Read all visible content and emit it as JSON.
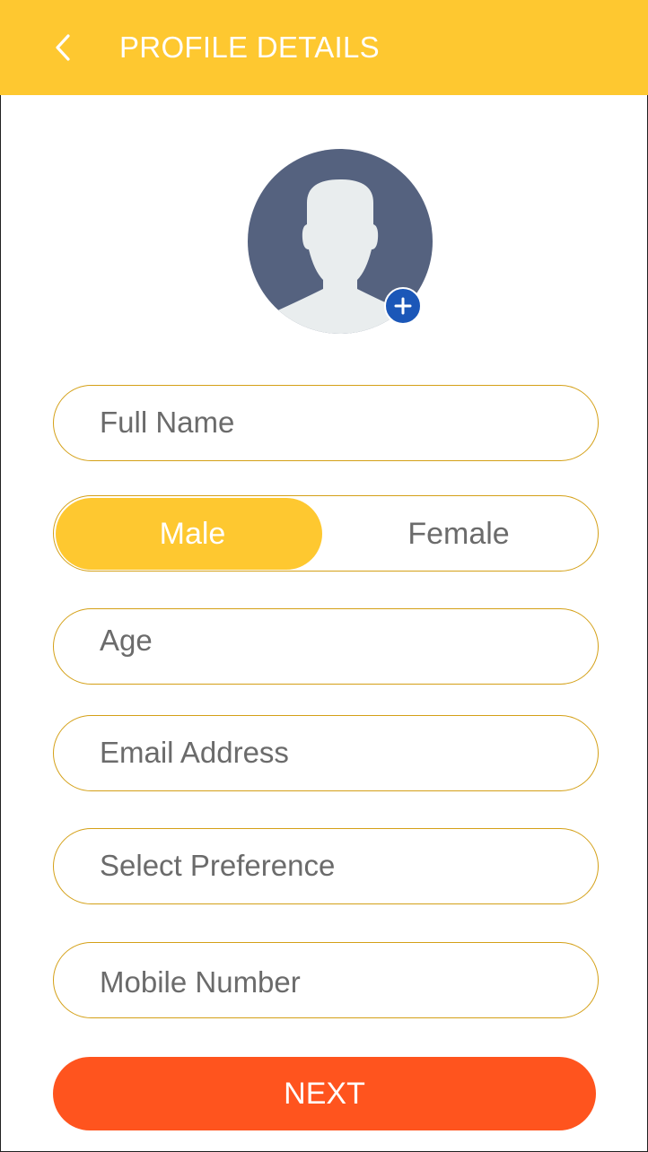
{
  "header": {
    "back_icon": "chevron-left-icon",
    "title": "PROFILE DETAILS",
    "background_color": "#FEC830"
  },
  "avatar": {
    "icon": "user-silhouette-icon",
    "add_icon": "plus-icon",
    "add_button_color": "#1B57B8"
  },
  "form": {
    "full_name_placeholder": "Full Name",
    "gender": {
      "male_label": "Male",
      "female_label": "Female",
      "selected": "Male"
    },
    "age_placeholder": "Age",
    "email_placeholder": "Email Address",
    "preference_placeholder": "Select Preference",
    "mobile_placeholder": "Mobile Number"
  },
  "actions": {
    "next_label": "NEXT",
    "next_color": "#FF541E"
  }
}
